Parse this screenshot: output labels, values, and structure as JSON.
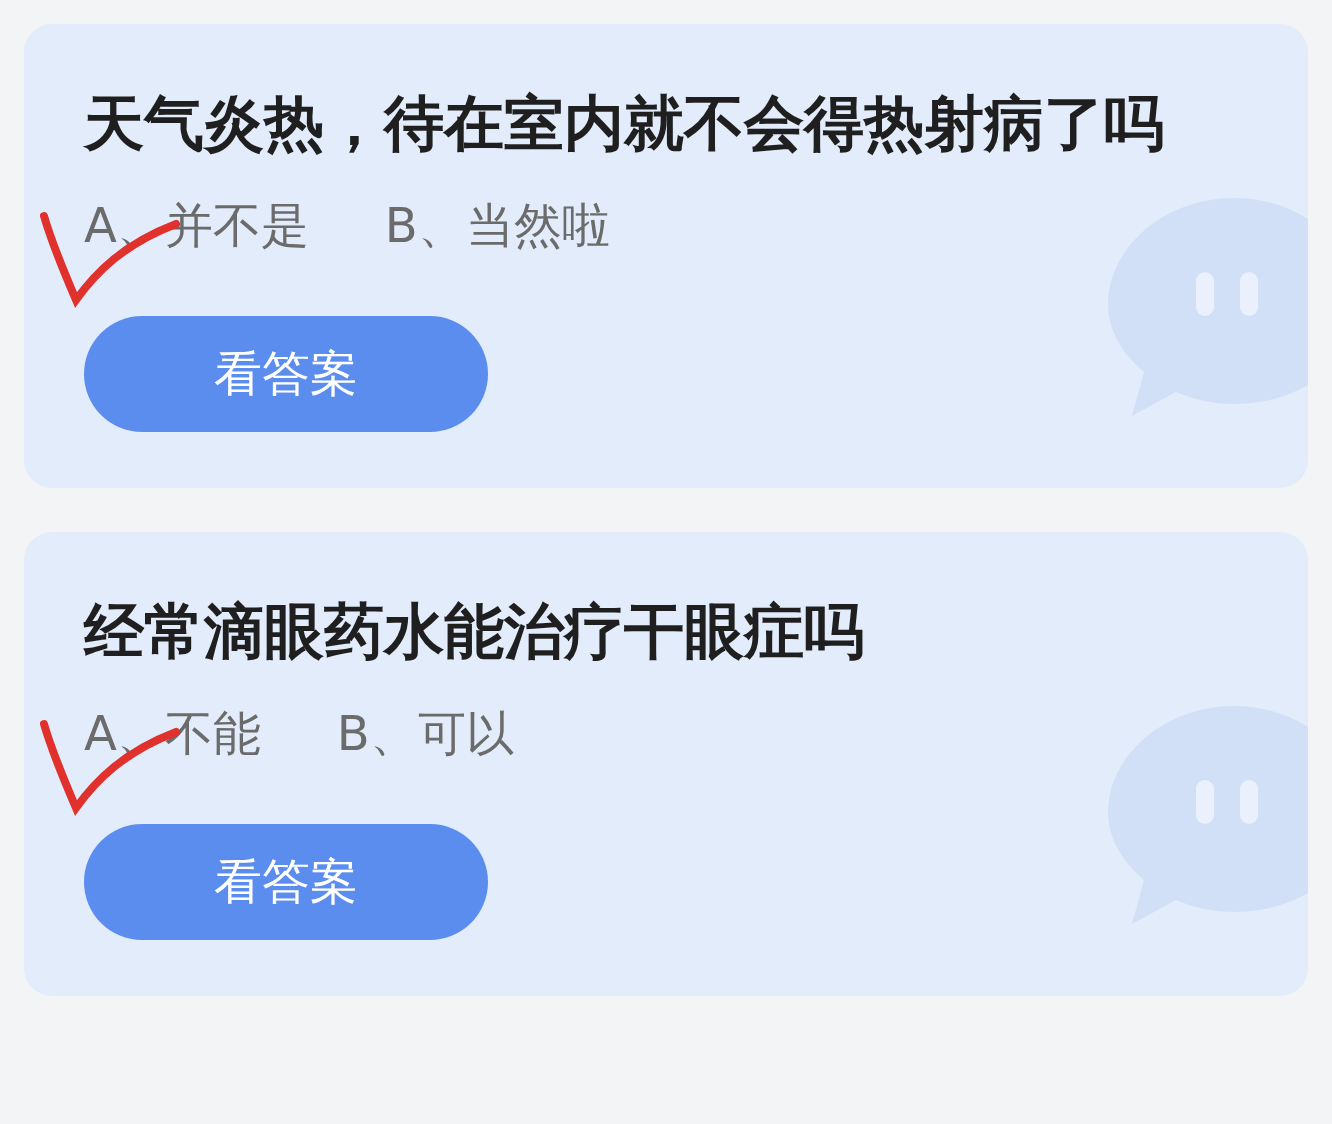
{
  "questions": [
    {
      "title": "天气炎热，待在室内就不会得热射病了吗",
      "options": [
        {
          "text": "A、并不是",
          "marked": true
        },
        {
          "text": "B、当然啦",
          "marked": false
        }
      ],
      "button": "看答案"
    },
    {
      "title": "经常滴眼药水能治疗干眼症吗",
      "options": [
        {
          "text": "A、不能",
          "marked": true
        },
        {
          "text": "B、可以",
          "marked": false
        }
      ],
      "button": "看答案"
    }
  ]
}
